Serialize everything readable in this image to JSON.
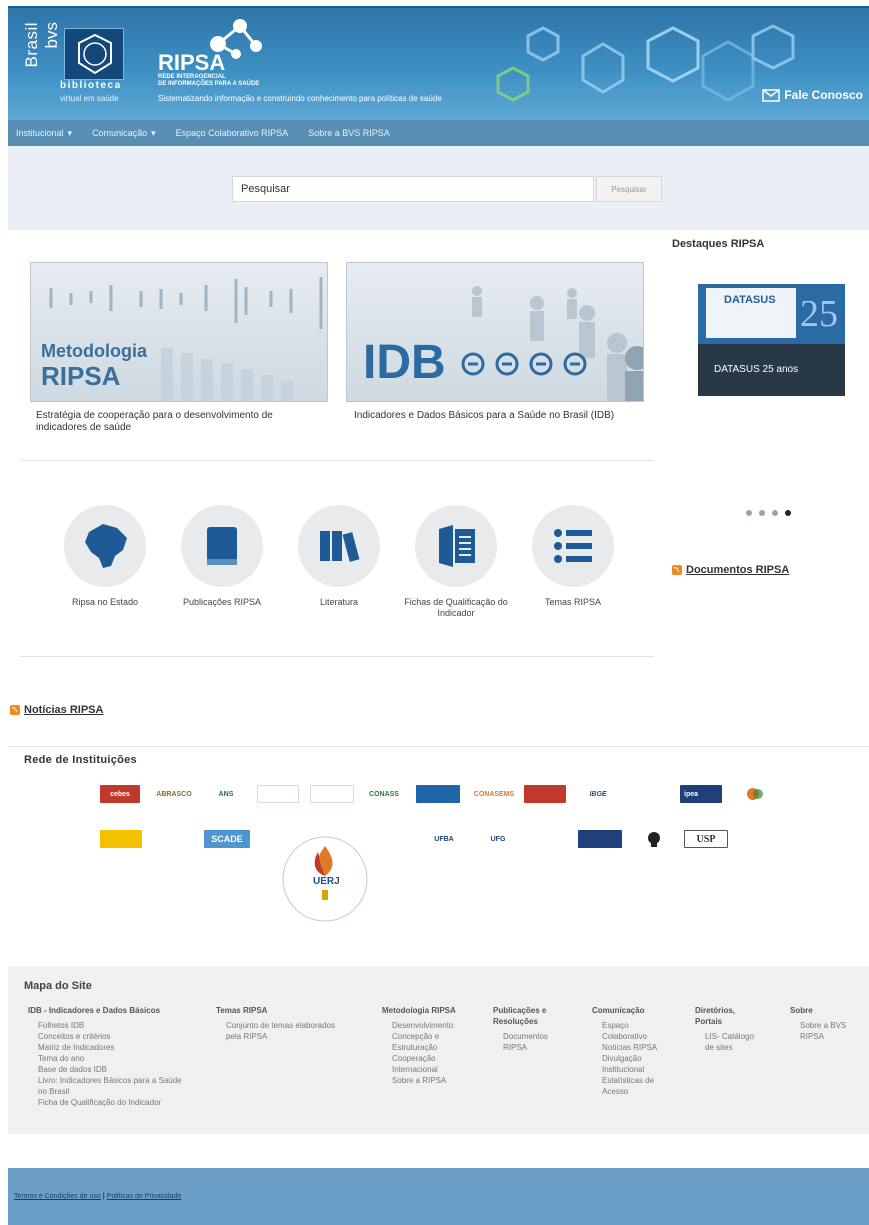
{
  "header": {
    "bvs_vertical": "Brasil",
    "bvs_vertical2": "bvs",
    "biblioteca": "biblioteca",
    "biblioteca_sub": "virtual em saúde",
    "ripsa_name": "RIPSA",
    "ripsa_sub1": "REDE INTERAGENCIAL",
    "ripsa_sub2": "DE INFORMAÇÕES PARA A SAÚDE",
    "ripsa_tagline": "Sistematizando informação e construindo conhecimento para políticas de saúde",
    "contact_label": "Fale Conosco"
  },
  "nav": {
    "items": [
      {
        "label": "Institucional",
        "dropdown": true
      },
      {
        "label": "Comunicação",
        "dropdown": true
      },
      {
        "label": "Espaço Colaborativo RIPSA",
        "dropdown": false
      },
      {
        "label": "Sobre a BVS RIPSA",
        "dropdown": false
      }
    ]
  },
  "search": {
    "value": "Pesquisar",
    "button_label": "Pesquisar"
  },
  "cards": [
    {
      "big_line1": "Metodologia",
      "big_line2": "RIPSA",
      "caption": "Estratégia de cooperação para o desenvolvimento de indicadores de saúde"
    },
    {
      "big": "IDB",
      "caption": "Indicadores e Dados Básicos para a Saúde no Brasil (IDB)"
    }
  ],
  "sidebar": {
    "title": "Destaques RIPSA",
    "highlight_brand": "DATASUS",
    "highlight_caption": "DATASUS 25 anos",
    "dots_active_index": 3,
    "documents_link": "Documentos RIPSA"
  },
  "shortcuts": [
    {
      "label": "Ripsa no Estado",
      "icon": "brazil-map-icon"
    },
    {
      "label": "Publicações RIPSA",
      "icon": "book-icon"
    },
    {
      "label": "Literatura",
      "icon": "books-icon"
    },
    {
      "label": "Fichas de Qualificação do Indicador",
      "icon": "document-door-icon"
    },
    {
      "label": "Temas RIPSA",
      "icon": "list-icon"
    }
  ],
  "news_link": "Notícias RIPSA",
  "institutions": {
    "title": "Rede de Instituições",
    "row1": [
      "cebes",
      "ABRASCO",
      "ANS",
      "",
      "",
      "CONASS",
      "",
      "CONASEMS",
      "",
      "IBGE",
      "",
      "ipea",
      ""
    ],
    "row2": [
      "",
      "",
      "SCADE",
      "UFBA",
      "UFG",
      "",
      "",
      "",
      "USP"
    ],
    "uerj_label": "UERJ",
    "uerj_ring": "UNIVERSIDADE DO ESTADO DO RIO DE JANEIRO"
  },
  "footer": {
    "title": "Mapa do Site",
    "columns": [
      {
        "heading": "IDB - Indicadores e Dados Básicos",
        "links": [
          "Folhetos IDB",
          "Conceitos e critérios",
          "Matriz de Indicadores",
          "Tema do ano",
          "Base de dados IDB",
          "Livro: Indicadores Básicos para a Saúde no Brasil",
          "Ficha de Qualificação do Indicador"
        ]
      },
      {
        "heading": "Temas RIPSA",
        "links": [
          "Conjunto de temas elaborados pela RIPSA"
        ]
      },
      {
        "heading": "Metodologia RIPSA",
        "links": [
          "Desenvolvimento",
          "Concepção e Estruturação",
          "Cooperação Internacional",
          "Sobre a RIPSA"
        ]
      },
      {
        "heading": "Publicações e Resoluções",
        "links": [
          "Documentos RIPSA"
        ]
      },
      {
        "heading": "Comunicação",
        "links": [
          "Espaço Colaborativo",
          "Notícias RIPSA",
          "Divulgação Institucional",
          "Estatísticas de Acesso"
        ]
      },
      {
        "heading": "Diretórios, Portais",
        "links": [
          "LIS- Catálogo de sites"
        ]
      },
      {
        "heading": "Sobre",
        "links": [
          "Sobre a BVS RIPSA"
        ]
      }
    ]
  },
  "bottom": {
    "terms": "Termos e Condições de uso",
    "sep": "|",
    "privacy": "Políticas de Privacidade"
  }
}
